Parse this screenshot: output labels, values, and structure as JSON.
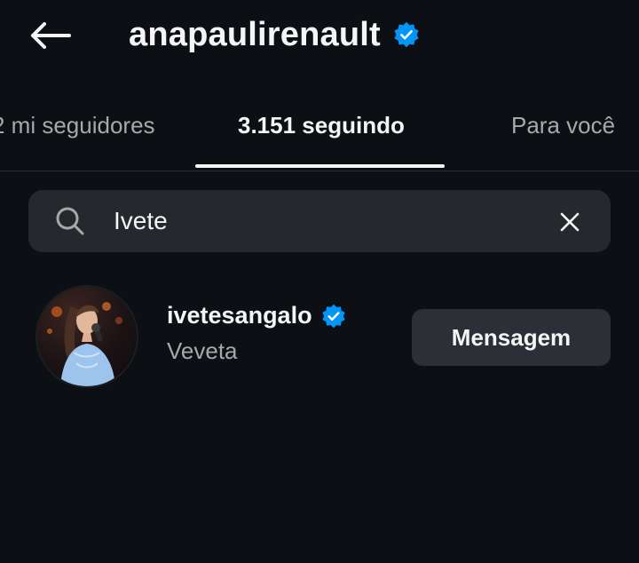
{
  "header": {
    "title": "anapaulirenault",
    "back_icon": "arrow-left-icon",
    "verified_icon": "verified-badge-icon",
    "verified_color": "#0095f6"
  },
  "tabs": [
    {
      "label": "2 mi seguidores",
      "active": false
    },
    {
      "label": "3.151 seguindo",
      "active": true
    },
    {
      "label": "Para você",
      "active": false
    }
  ],
  "search": {
    "value": "Ivete",
    "placeholder": "",
    "search_icon": "search-icon",
    "clear_icon": "close-icon"
  },
  "results": [
    {
      "username": "ivetesangalo",
      "full_name": "Veveta",
      "verified": true,
      "button_label": "Mensagem"
    }
  ],
  "colors": {
    "background": "#0c1014",
    "surface": "#25292e",
    "button": "#2c3036",
    "text_primary": "#f5f5f5",
    "text_secondary": "#a8a8a8"
  }
}
